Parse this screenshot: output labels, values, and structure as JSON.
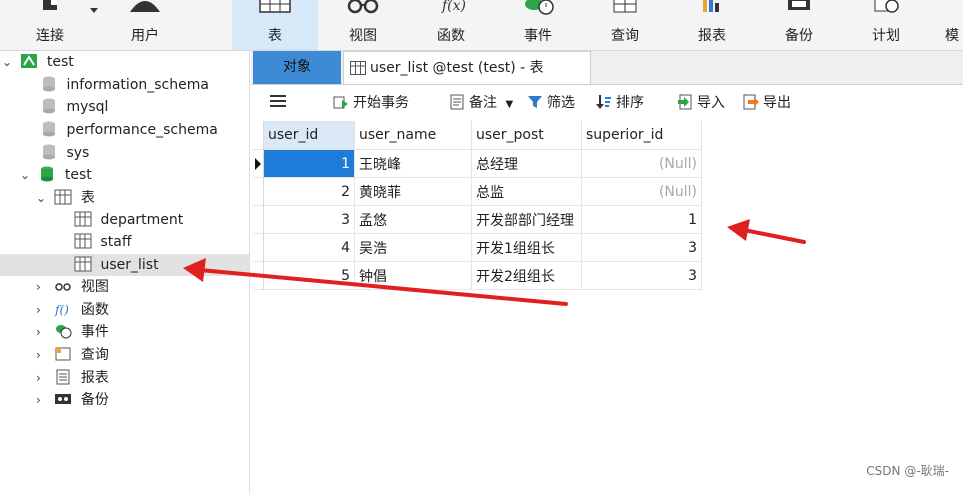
{
  "toolbar": {
    "buttons": [
      {
        "label": "连接"
      },
      {
        "label": "用户"
      },
      {
        "label": "表"
      },
      {
        "label": "视图"
      },
      {
        "label": "函数"
      },
      {
        "label": "事件"
      },
      {
        "label": "查询"
      },
      {
        "label": "报表"
      },
      {
        "label": "备份"
      },
      {
        "label": "计划"
      },
      {
        "label": "模"
      }
    ],
    "active": "表"
  },
  "tree": {
    "connection": "test",
    "databases": [
      "information_schema",
      "mysql",
      "performance_schema",
      "sys",
      "test"
    ],
    "tables_group": "表",
    "tables": [
      "department",
      "staff",
      "user_list"
    ],
    "selected_table": "user_list",
    "other_groups": [
      "视图",
      "函数",
      "事件",
      "查询",
      "报表",
      "备份"
    ]
  },
  "tabs": {
    "objects": "对象",
    "table_tab": "user_list @test (test) - 表"
  },
  "subtoolbar": {
    "begin_tx": "开始事务",
    "memo": "备注",
    "filter": "筛选",
    "sort": "排序",
    "import": "导入",
    "export": "导出"
  },
  "grid": {
    "columns": [
      "user_id",
      "user_name",
      "user_post",
      "superior_id"
    ],
    "rows": [
      {
        "user_id": "1",
        "user_name": "王晓峰",
        "user_post": "总经理",
        "superior_id": "(Null)"
      },
      {
        "user_id": "2",
        "user_name": "黄晓菲",
        "user_post": "总监",
        "superior_id": "(Null)"
      },
      {
        "user_id": "3",
        "user_name": "孟悠",
        "user_post": "开发部部门经理",
        "superior_id": "1"
      },
      {
        "user_id": "4",
        "user_name": "吴浩",
        "user_post": "开发1组组长",
        "superior_id": "3"
      },
      {
        "user_id": "5",
        "user_name": "钟倡",
        "user_post": "开发2组组长",
        "superior_id": "3"
      }
    ]
  },
  "watermark": "CSDN @-耿瑞-",
  "colors": {
    "active_tab": "#3d8bd4",
    "selected_cell": "#1e7bd8",
    "annotation_arrow": "#e02020"
  }
}
